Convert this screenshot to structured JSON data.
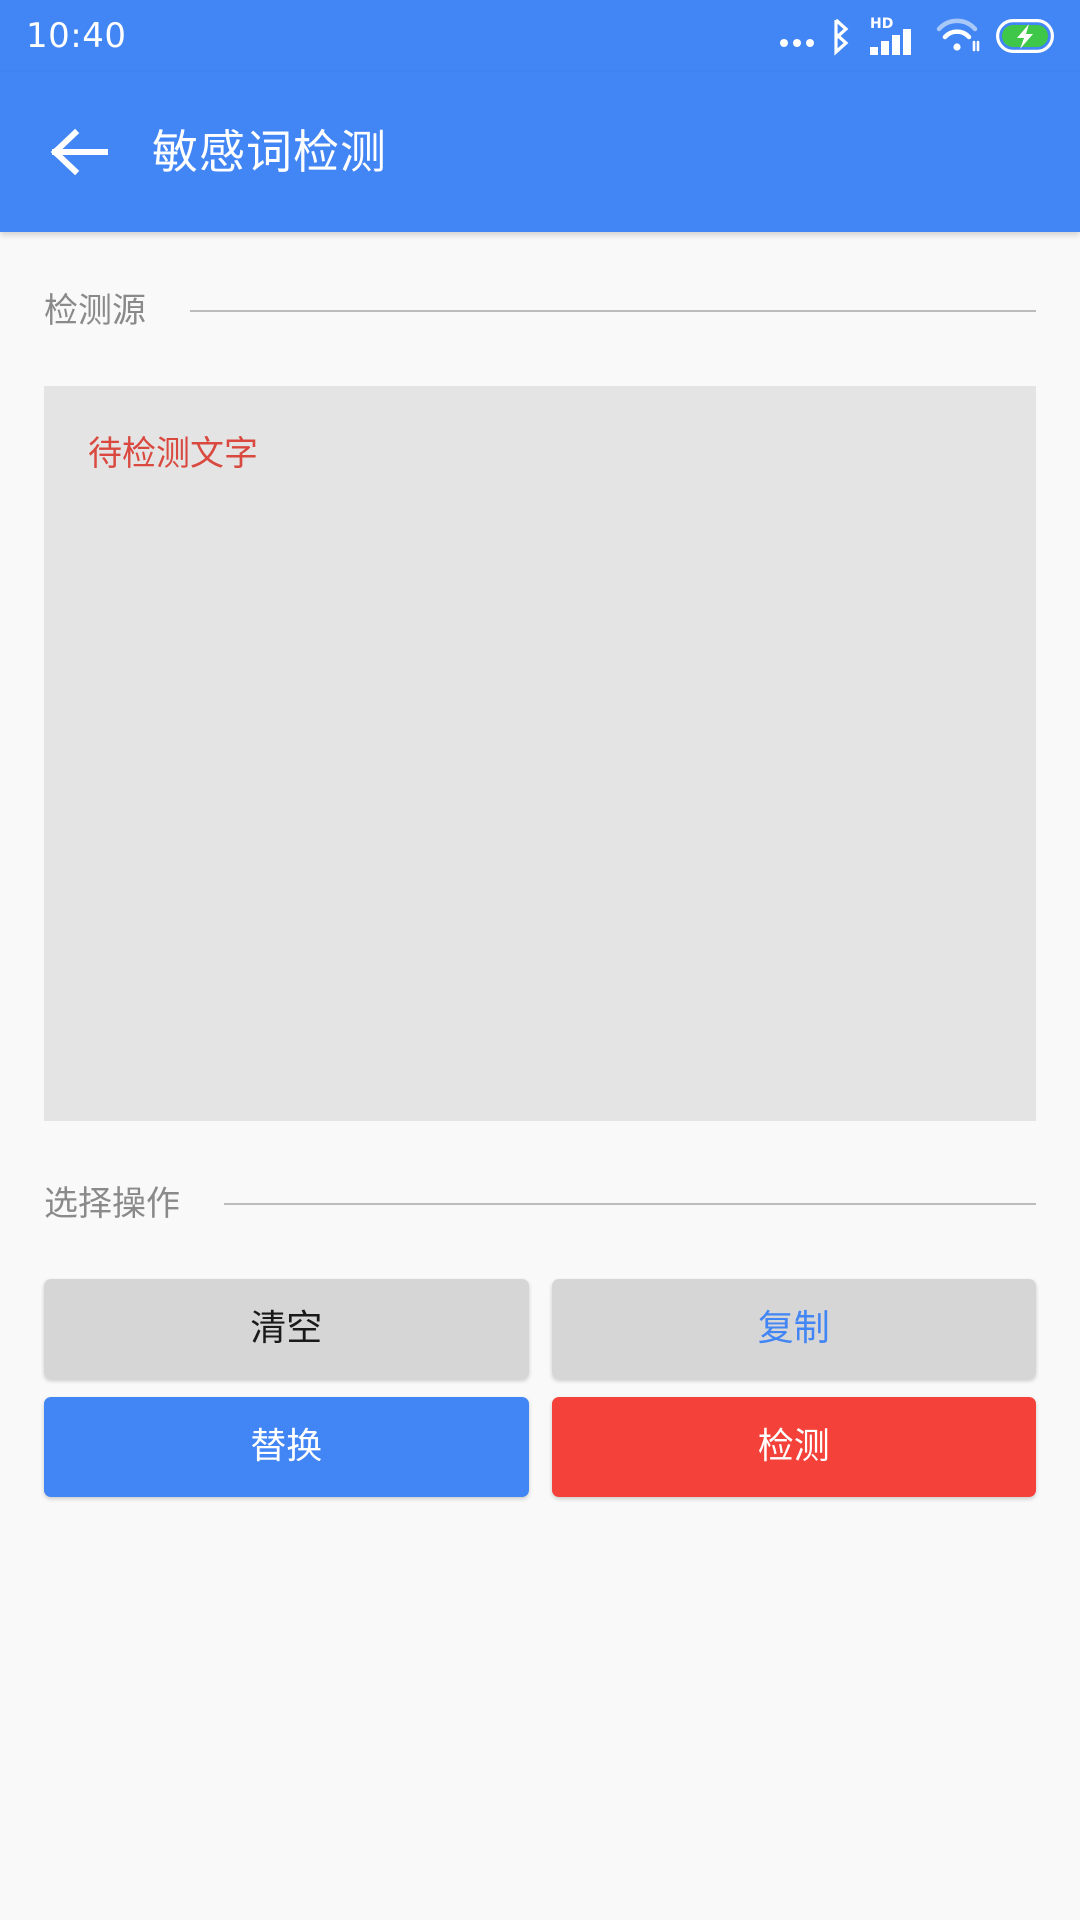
{
  "status_bar": {
    "time": "10:40",
    "icons": [
      {
        "name": "more-dots-icon"
      },
      {
        "name": "bluetooth-icon"
      },
      {
        "name": "hd-signal-icon",
        "label": "HD"
      },
      {
        "name": "wifi-icon"
      },
      {
        "name": "battery-charging-icon"
      }
    ]
  },
  "app_bar": {
    "back_icon": "back-arrow-icon",
    "title": "敏感词检测"
  },
  "sections": {
    "source": {
      "label": "检测源",
      "textarea_placeholder": "待检测文字",
      "textarea_value": ""
    },
    "operations": {
      "label": "选择操作",
      "buttons": [
        {
          "label": "清空",
          "style": "grey-dark"
        },
        {
          "label": "复制",
          "style": "grey-blue"
        },
        {
          "label": "替换",
          "style": "blue"
        },
        {
          "label": "检测",
          "style": "red"
        }
      ]
    }
  },
  "colors": {
    "primary_blue": "#4285f4",
    "danger_red": "#f4423a",
    "placeholder_red": "#d9493f",
    "button_grey": "#d6d6d6",
    "textarea_bg": "#e4e4e4",
    "page_bg": "#f9f9f9",
    "section_label": "#8a8a8a",
    "rule": "#bcbcbc"
  }
}
